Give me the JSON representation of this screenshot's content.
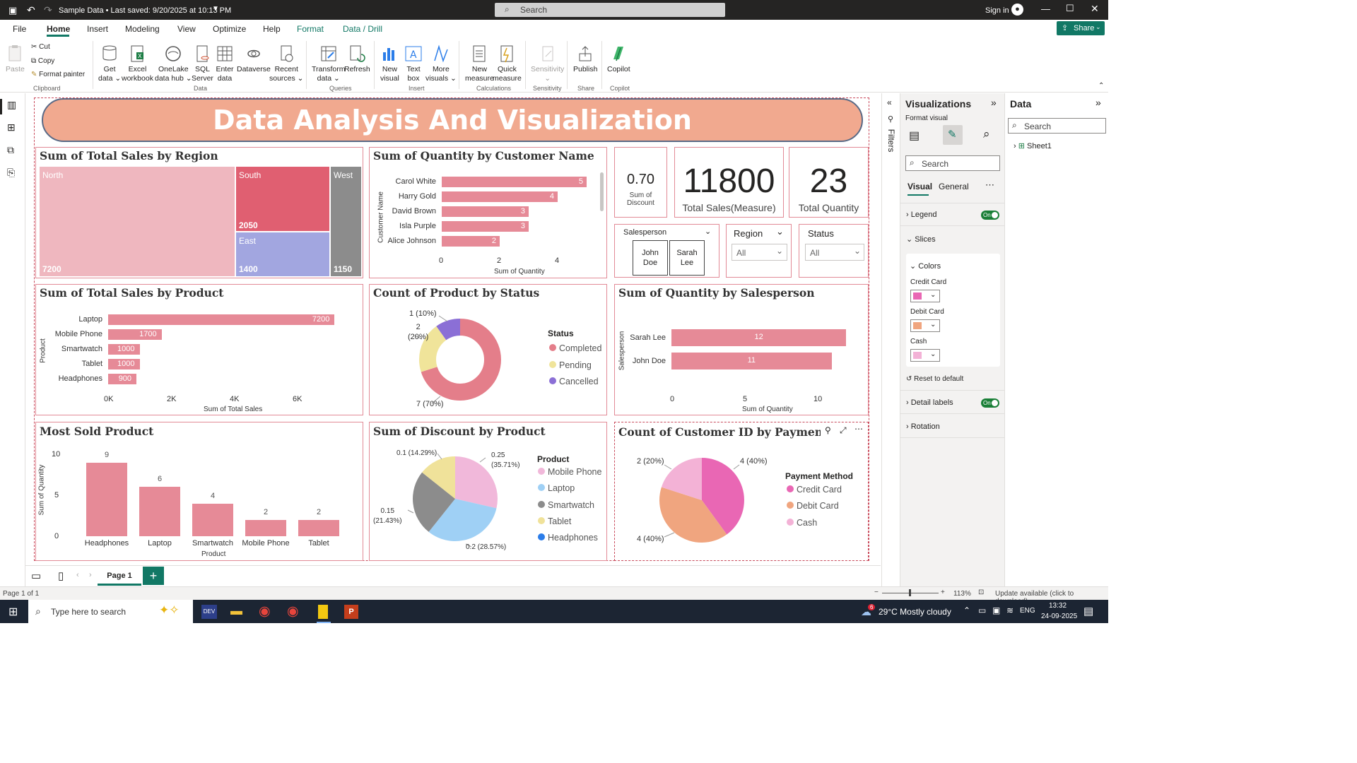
{
  "titlebar": {
    "file_title": "Sample Data • Last saved: 9/20/2025 at 10:13 PM",
    "search_placeholder": "Search",
    "sign_in": "Sign in"
  },
  "menu": {
    "items": [
      "File",
      "Home",
      "Insert",
      "Modeling",
      "View",
      "Optimize",
      "Help",
      "Format",
      "Data / Drill"
    ],
    "active": "Home",
    "share": "Share"
  },
  "ribbon": {
    "clipboard": {
      "paste": "Paste",
      "cut": "Cut",
      "copy": "Copy",
      "format_painter": "Format painter",
      "group": "Clipboard"
    },
    "data": {
      "get_data_1": "Get",
      "get_data_2": "data",
      "excel_1": "Excel",
      "excel_2": "workbook",
      "onelake_1": "OneLake",
      "onelake_2": "data hub",
      "sql_1": "SQL",
      "sql_2": "Server",
      "enter_1": "Enter",
      "enter_2": "data",
      "dataverse": "Dataverse",
      "recent_1": "Recent",
      "recent_2": "sources",
      "group": "Data"
    },
    "queries": {
      "transform_1": "Transform",
      "transform_2": "data",
      "refresh": "Refresh",
      "group": "Queries"
    },
    "insert": {
      "newvisual_1": "New",
      "newvisual_2": "visual",
      "textbox_1": "Text",
      "textbox_2": "box",
      "more_1": "More",
      "more_2": "visuals",
      "group": "Insert"
    },
    "calculations": {
      "newmeasure_1": "New",
      "newmeasure_2": "measure",
      "quick_1": "Quick",
      "quick_2": "measure",
      "group": "Calculations"
    },
    "sensitivity": {
      "label": "Sensitivity",
      "group": "Sensitivity"
    },
    "share": {
      "label": "Publish",
      "group": "Share"
    },
    "copilot": {
      "label": "Copilot",
      "group": "Copilot"
    }
  },
  "banner": {
    "title": "Data Analysis And Visualization"
  },
  "treemap": {
    "title": "Sum of Total Sales by Region",
    "north": "North",
    "north_val": "7200",
    "south": "South",
    "south_val": "2050",
    "east": "East",
    "east_val": "1400",
    "west": "West",
    "west_val": "1150"
  },
  "cust": {
    "title": "Sum of Quantity by Customer Name",
    "ylabel": "Customer Name",
    "xlabel": "Sum of Quantity",
    "ticks": [
      "0",
      "2",
      "4"
    ],
    "rows": [
      {
        "name": "Carol White",
        "value": "5"
      },
      {
        "name": "Harry Gold",
        "value": "4"
      },
      {
        "name": "David Brown",
        "value": "3"
      },
      {
        "name": "Isla Purple",
        "value": "3"
      },
      {
        "name": "Alice Johnson",
        "value": "2"
      }
    ]
  },
  "cards": {
    "discount_val": "0.70",
    "discount_l1": "Sum of",
    "discount_l2": "Discount",
    "sales_val": "11800",
    "sales_lbl": "Total Sales(Measure)",
    "qty_val": "23",
    "qty_lbl": "Total Quantity"
  },
  "slicers": {
    "sp_title": "Salesperson",
    "sp_opt1_a": "John",
    "sp_opt1_b": "Doe",
    "sp_opt2_a": "Sarah",
    "sp_opt2_b": "Lee",
    "region_title": "Region",
    "region_val": "All",
    "status_title": "Status",
    "status_val": "All"
  },
  "product": {
    "title": "Sum of Total Sales by Product",
    "ylabel": "Product",
    "xlabel": "Sum of Total Sales",
    "ticks": [
      "0K",
      "2K",
      "4K",
      "6K"
    ],
    "rows": [
      {
        "name": "Laptop",
        "value": "7200"
      },
      {
        "name": "Mobile Phone",
        "value": "1700"
      },
      {
        "name": "Smartwatch",
        "value": "1000"
      },
      {
        "name": "Tablet",
        "value": "1000"
      },
      {
        "name": "Headphones",
        "value": "900"
      }
    ]
  },
  "status": {
    "title": "Count of Product by Status",
    "legend_title": "Status",
    "lbl_cancel": "1 (10%)",
    "lbl_pend_1": "2",
    "lbl_pend_2": "(20%)",
    "lbl_comp": "7 (70%)",
    "legend": [
      "Completed",
      "Pending",
      "Cancelled"
    ]
  },
  "salesp": {
    "title": "Sum of Quantity by Salesperson",
    "ylabel": "Salesperson",
    "xlabel": "Sum of Quantity",
    "ticks": [
      "0",
      "5",
      "10"
    ],
    "rows": [
      {
        "name": "Sarah Lee",
        "value": "12"
      },
      {
        "name": "John Doe",
        "value": "11"
      }
    ]
  },
  "most": {
    "title": "Most Sold Product",
    "ylabel": "Sum of Quantity",
    "xlabel": "Product",
    "ticks": [
      "10",
      "5",
      "0"
    ],
    "cols": [
      {
        "name": "Headphones",
        "value": "9"
      },
      {
        "name": "Laptop",
        "value": "6"
      },
      {
        "name": "Smartwatch",
        "value": "4"
      },
      {
        "name": "Mobile Phone",
        "value": "2"
      },
      {
        "name": "Tablet",
        "value": "2"
      }
    ]
  },
  "disc": {
    "title": "Sum of Discount by Product",
    "legend_title": "Product",
    "l_tablet": "0.1 (14.29%)",
    "l_mob_1": "0.25",
    "l_mob_2": "(35.71%)",
    "l_smart_1": "0.15",
    "l_smart_2": "(21.43%)",
    "l_lap": "0.2 (28.57%)",
    "legend": [
      "Mobile Phone",
      "Laptop",
      "Smartwatch",
      "Tablet",
      "Headphones"
    ]
  },
  "pay": {
    "title": "Count of Customer ID by Payment M",
    "legend_title": "Payment Method",
    "l_cash": "2 (20%)",
    "l_credit": "4 (40%)",
    "l_debit": "4 (40%)",
    "legend": [
      "Credit Card",
      "Debit Card",
      "Cash"
    ]
  },
  "filters": {
    "label": "Filters"
  },
  "viz": {
    "title": "Visualizations",
    "format_visual": "Format visual",
    "search": "Search",
    "tab_visual": "Visual",
    "tab_general": "General",
    "legend": "Legend",
    "on": "On",
    "slices": "Slices",
    "colors": "Colors",
    "credit": "Credit Card",
    "debit": "Debit Card",
    "cash": "Cash",
    "reset": "Reset to default",
    "detail": "Detail labels",
    "rotation": "Rotation"
  },
  "datapane": {
    "title": "Data",
    "search": "Search",
    "sheet": "Sheet1"
  },
  "pages": {
    "page1": "Page 1"
  },
  "status_bar": {
    "page": "Page 1 of 1",
    "zoom": "113%",
    "update": "Update available (click to download)"
  },
  "taskbar": {
    "search": "Type here to search",
    "weather": "29°C  Mostly cloudy",
    "lang": "ENG",
    "time": "13:32",
    "date": "24-09-2025",
    "notif": "6"
  },
  "colors": {
    "accent": "#117865",
    "bar": "#e68a97",
    "completed": "#e47e8a",
    "pending": "#f0e49a",
    "cancelled": "#8b6fd6",
    "mobile": "#f1b8da",
    "laptop": "#9fd0f5",
    "smartwatch": "#8c8c8c",
    "tablet": "#f0e29a",
    "headphones": "#2b7de9",
    "credit": "#e967b4",
    "debit": "#f0a57f",
    "cash": "#f3b2d6"
  }
}
